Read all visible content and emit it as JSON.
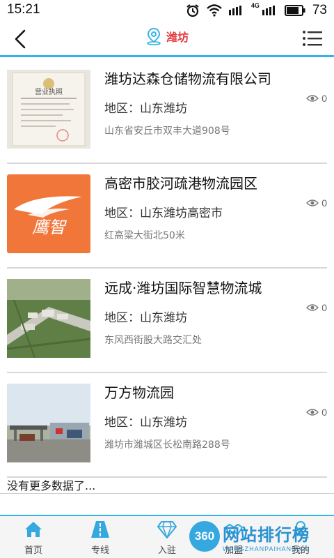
{
  "status_bar": {
    "time": "15:21",
    "network": "4G",
    "battery": "73",
    "icons": [
      "alarm-icon",
      "wifi-icon",
      "signal-icon",
      "signal-4g-icon",
      "battery-icon"
    ]
  },
  "nav": {
    "title": "潍坊",
    "back_icon": "back-arrow-icon",
    "location_icon": "location-pin-icon",
    "menu_icon": "list-menu-icon"
  },
  "colors": {
    "accent": "#35b5e6",
    "title_red": "#e23a3a"
  },
  "items": [
    {
      "title": "潍坊达森仓储物流有限公司",
      "region": "地区：山东潍坊",
      "address": "山东省安丘市双丰大道908号",
      "views": "0",
      "image": "business-license-photo",
      "image_text": [
        "营业执照"
      ]
    },
    {
      "title": "高密市胶河疏港物流园区",
      "region": "地区：山东潍坊高密市",
      "address": "红高粱大街北50米",
      "views": "0",
      "image": "eagle-logo",
      "image_text": [
        "鹰智"
      ]
    },
    {
      "title": "远成·潍坊国际智慧物流城",
      "region": "地区：山东潍坊",
      "address": "东风西街股大路交汇处",
      "views": "0",
      "image": "aerial-park-rendering"
    },
    {
      "title": "万方物流园",
      "region": "地区：山东潍坊",
      "address": "潍坊市潍城区长松南路288号",
      "views": "0",
      "image": "logistics-gate-photo"
    }
  ],
  "no_more_text": "没有更多数据了...",
  "tabs": [
    {
      "label": "首页",
      "icon": "home-icon"
    },
    {
      "label": "专线",
      "icon": "road-icon"
    },
    {
      "label": "入驻",
      "icon": "diamond-icon"
    },
    {
      "label": "加盟",
      "icon": "handshake-icon"
    },
    {
      "label": "我的",
      "icon": "user-icon"
    }
  ],
  "watermark": {
    "badge": "360",
    "cn": "网站排行榜",
    "en": "WANGZHANPAIHANG.CN"
  }
}
